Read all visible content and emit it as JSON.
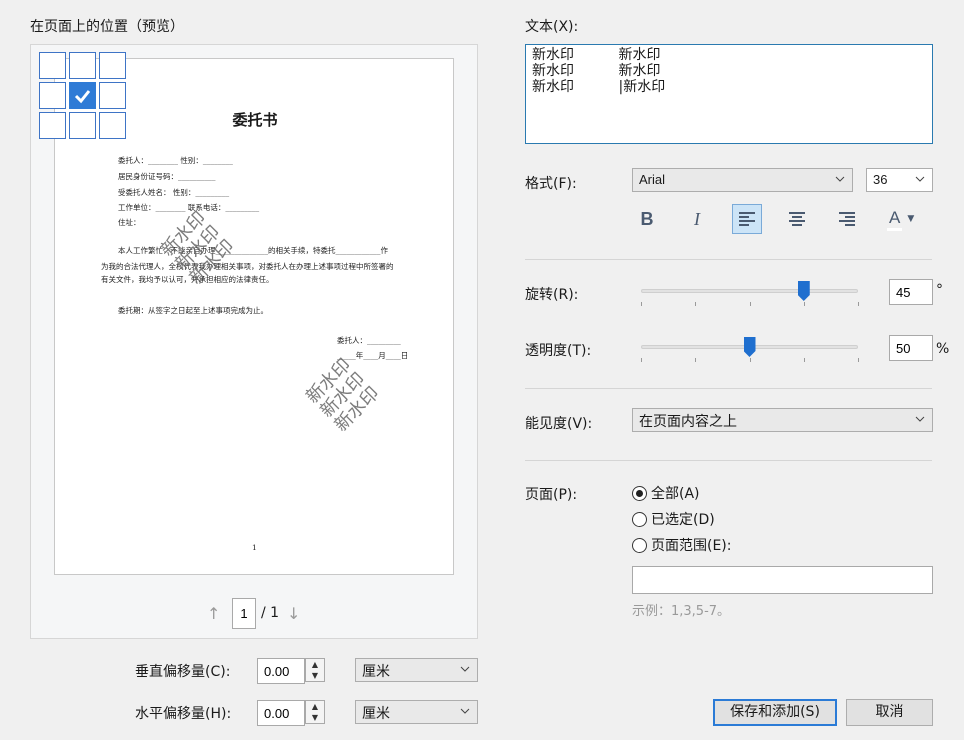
{
  "preview": {
    "title": "在页面上的位置（预览）",
    "page_input": "1",
    "page_total": "/ 1",
    "doc": {
      "title": "委托书",
      "lines": [
        "委托人：________    性别：________",
        "居民身份证号码：__________",
        "受委托人姓名：              性别：_________",
        "工作单位：________ 联系电话：_________",
        "住址：",
        "本人工作繁忙，不能亲自办理______________的相关手续，特委托____________作",
        "为我的合法代理人，全权代表我办理相关事项，对委托人在办理上述事项过程中所签署的",
        "有关文件，我均予以认可，并承担相应的法律责任。",
        "委托期：从签字之日起至上述事项完成为止。",
        "委托人：_________",
        "_____年____月____日"
      ],
      "page_number": "1"
    }
  },
  "offsets": {
    "vertical_label": "垂直偏移量(C):",
    "vertical_value": "0.00",
    "vertical_unit": "厘米",
    "horizontal_label": "水平偏移量(H):",
    "horizontal_value": "0.00",
    "horizontal_unit": "厘米"
  },
  "text": {
    "label": "文本(X):",
    "lines": [
      "新水印          新水印",
      "新水印          新水印",
      "新水印          |新水印"
    ]
  },
  "format": {
    "label": "格式(F):",
    "font": "Arial",
    "size": "36",
    "bold": "B",
    "italic": "I",
    "font_color": "A"
  },
  "rotation": {
    "label": "旋转(R):",
    "value": "45",
    "unit": "°",
    "fraction": 0.75
  },
  "opacity": {
    "label": "透明度(T):",
    "value": "50",
    "unit": "%",
    "fraction": 0.5
  },
  "visibility": {
    "label": "能见度(V):",
    "value": "在页面内容之上"
  },
  "pages": {
    "label": "页面(P):",
    "options": [
      "全部(A)",
      "已选定(D)",
      "页面范围(E):"
    ],
    "selected": 0,
    "range_value": "",
    "example": "示例：1,3,5-7。"
  },
  "buttons": {
    "save": "保存和添加(S)",
    "cancel": "取消"
  },
  "watermark_text": "新水印",
  "colors": {
    "accent": "#2f7bd6",
    "focus_border": "#2a7ab0"
  }
}
